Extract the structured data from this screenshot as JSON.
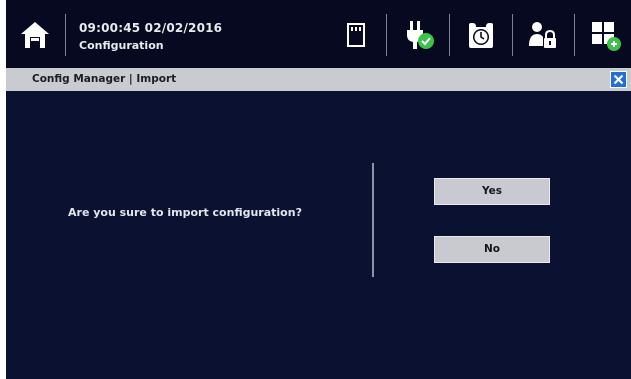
{
  "header": {
    "datetime": "09:00:45 02/02/2016",
    "screen_name": "Configuration",
    "icons": [
      "home-icon",
      "sd-card-icon",
      "power-plug-check-icon",
      "alarm-clock-icon",
      "user-lock-icon",
      "layout-grid-icon"
    ]
  },
  "dialog": {
    "title": "Config Manager | Import",
    "question": "Are you sure to import configuration?",
    "yes_label": "Yes",
    "no_label": "No"
  },
  "colors": {
    "background": "#0b1130",
    "topbar": "#06091f",
    "titlebar": "#c9cbd0",
    "close_button": "#1f6fd6",
    "status_ok": "#3cc24a"
  }
}
